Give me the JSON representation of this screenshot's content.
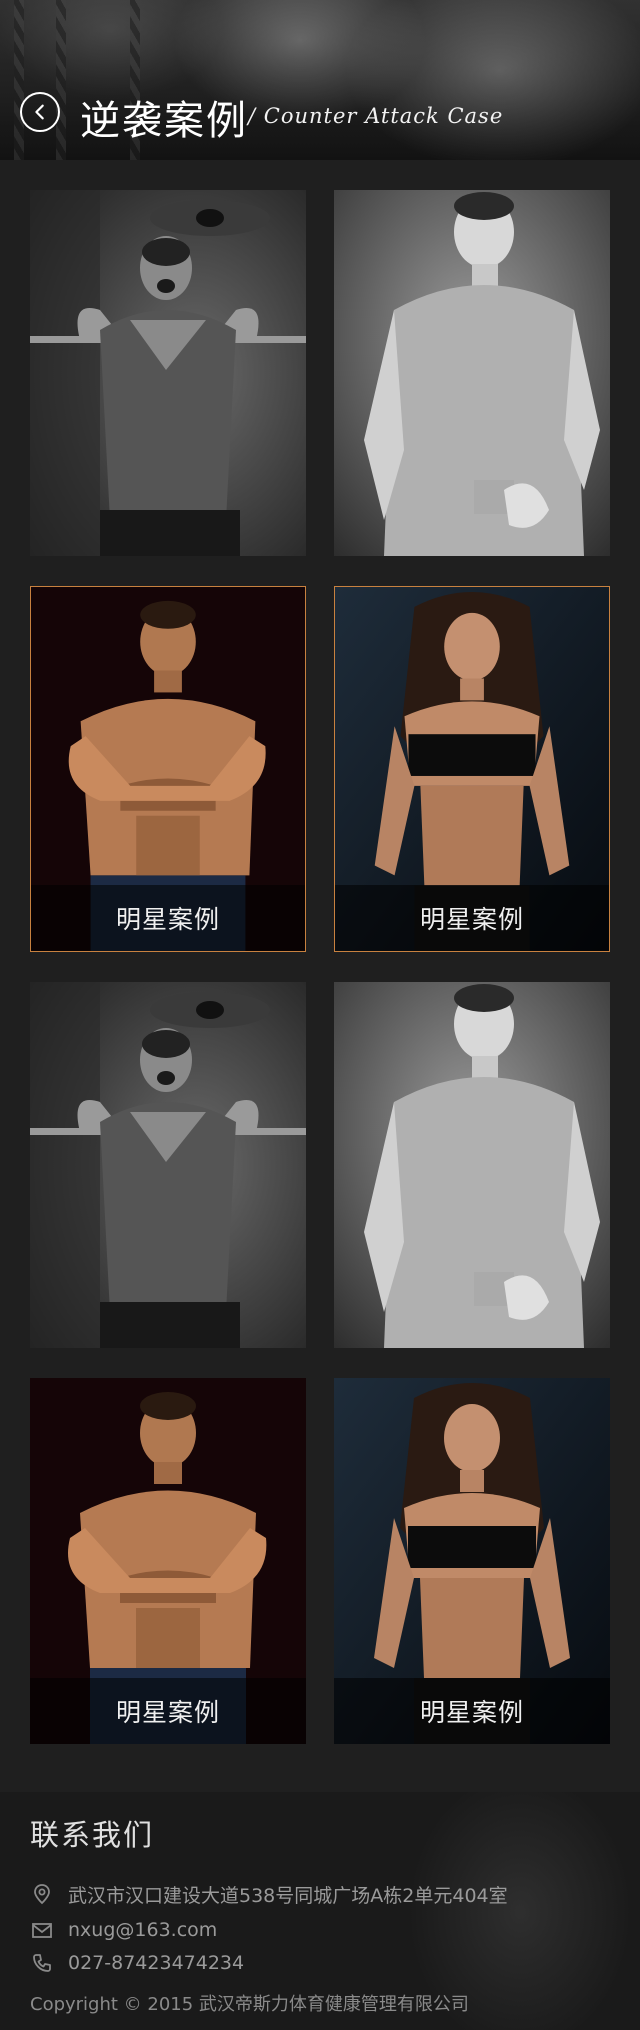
{
  "header": {
    "title": "逆袭案例",
    "subtitle": "/ Counter Attack Case",
    "back_icon": "chevron-left-circle-icon"
  },
  "cases": [
    {
      "type": "photo",
      "subject": "athlete-lifting-barbell",
      "tone": "grayscale"
    },
    {
      "type": "photo",
      "subject": "man-in-tshirt-with-dumbbell",
      "tone": "grayscale"
    },
    {
      "type": "photo",
      "subject": "shirtless-man-arms-crossed",
      "tone": "color",
      "caption": "明星案例",
      "featured": true
    },
    {
      "type": "photo",
      "subject": "woman-fitness-model",
      "tone": "color",
      "caption": "明星案例",
      "featured": true
    },
    {
      "type": "photo",
      "subject": "athlete-lifting-barbell",
      "tone": "grayscale"
    },
    {
      "type": "photo",
      "subject": "man-in-tshirt-with-dumbbell",
      "tone": "grayscale"
    },
    {
      "type": "photo",
      "subject": "shirtless-man-arms-crossed",
      "tone": "color",
      "caption": "明星案例"
    },
    {
      "type": "photo",
      "subject": "woman-fitness-model",
      "tone": "color",
      "caption": "明星案例"
    }
  ],
  "footer": {
    "contact_title": "联系我们",
    "address": "武汉市汉口建设大道538号同城广场A栋2单元404室",
    "email": "nxug@163.com",
    "phone": "027-87423474234",
    "copyright": "Copyright © 2015 武汉帝斯力体育健康管理有限公司",
    "icons": [
      "location-pin-icon",
      "mail-icon",
      "phone-icon"
    ]
  },
  "colors": {
    "background": "#1f1f1f",
    "featured_border": "#c8813f",
    "footer_text": "#9a9a9a"
  }
}
